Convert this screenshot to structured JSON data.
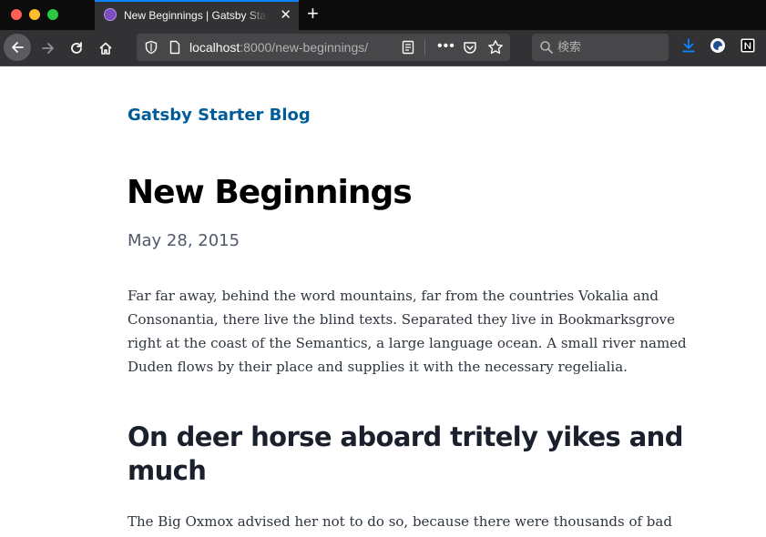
{
  "browser": {
    "tab": {
      "title": "New Beginnings | Gatsby Starter Blog"
    },
    "url": {
      "host": "localhost",
      "rest": ":8000/new-beginnings/"
    },
    "search": {
      "placeholder": "検索"
    },
    "colors": {
      "accent": "#0a84ff",
      "chrome_bg": "#0c0c0d",
      "toolbar_bg": "#323234"
    }
  },
  "site": {
    "title": "Gatsby Starter Blog",
    "title_color": "#005b99"
  },
  "post": {
    "title": "New Beginnings",
    "date": "May 28, 2015",
    "paragraphs": [
      "Far far away, behind the word mountains, far from the countries Vokalia and Consonantia, there live the blind texts. Separated they live in Bookmarksgrove right at the coast of the Semantics, a large language ocean. A small river named Duden flows by their place and supplies it with the necessary regelialia.",
      "The Big Oxmox advised her not to do so, because there were thousands of bad"
    ],
    "headings": [
      "On deer horse aboard tritely yikes and much"
    ]
  }
}
